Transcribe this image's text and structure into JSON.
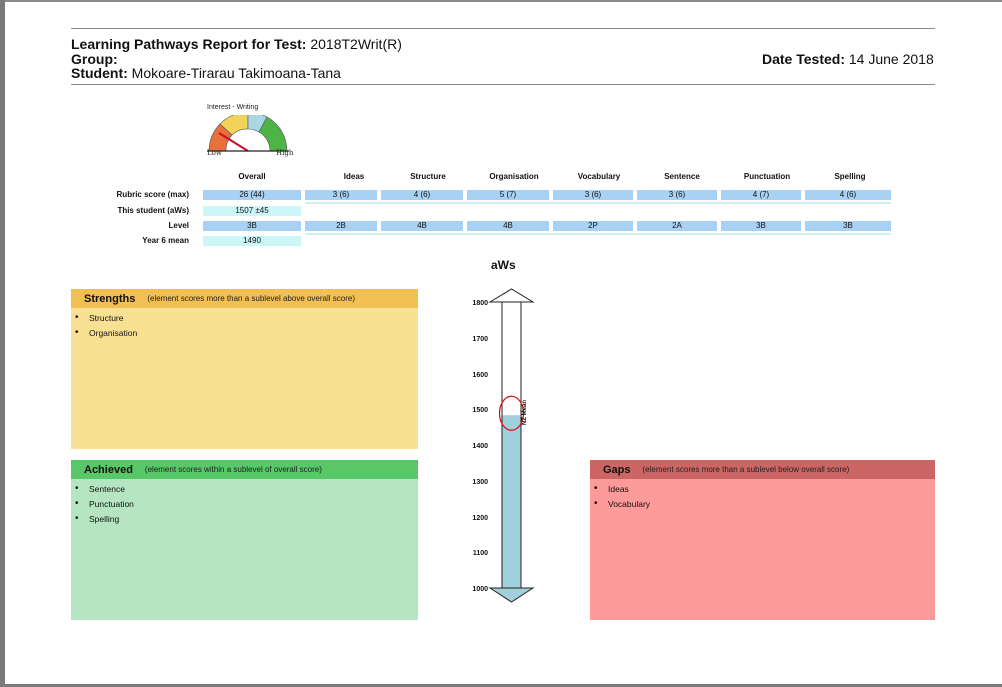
{
  "report": {
    "title_label": "Learning Pathways Report for Test:",
    "test_name": "2018T2Writ(R)",
    "group_label": "Group:",
    "group_value": "",
    "student_label": "Student:",
    "student_name": "Mokoare-Tirarau Takimoana-Tana",
    "date_label": "Date Tested:",
    "date_value": "14 June 2018"
  },
  "gauge": {
    "title": "Interest - Writing",
    "low": "Low",
    "high": "High",
    "colors": {
      "low": "#e8703a",
      "mid": "#f2d25a",
      "high": "#4fb447",
      "highlight": "#a9d7e6",
      "needle": "#c8102e"
    }
  },
  "table": {
    "columns": [
      "Overall",
      "Ideas",
      "Structure",
      "Organisation",
      "Vocabulary",
      "Sentence",
      "Punctuation",
      "Spelling"
    ],
    "row_labels": {
      "rubric": "Rubric score (max)",
      "student": "This student (aWs)",
      "level": "Level",
      "mean": "Year 6 mean"
    },
    "rubric": [
      "26 (44)",
      "3 (6)",
      "4 (6)",
      "5 (7)",
      "3 (6)",
      "3 (6)",
      "4 (7)",
      "4 (6)"
    ],
    "student": "1507 ±45",
    "level": [
      "3B",
      "2B",
      "4B",
      "4B",
      "2P",
      "2A",
      "3B",
      "3B"
    ],
    "mean": "1490"
  },
  "strengths": {
    "title": "Strengths",
    "desc": "(element scores more than a sublevel above overall score)",
    "items": [
      "Structure",
      "Organisation"
    ],
    "colors": {
      "head": "#f2bf52",
      "body": "#f9e194"
    }
  },
  "achieved": {
    "title": "Achieved",
    "desc": "(element scores within a sublevel of overall score)",
    "items": [
      "Sentence",
      "Punctuation",
      "Spelling"
    ],
    "colors": {
      "head": "#57c768",
      "body": "#b5e6c1"
    }
  },
  "gaps": {
    "title": "Gaps",
    "desc": "(element scores more than a sublevel below overall score)",
    "items": [
      "Ideas",
      "Vocabulary"
    ],
    "colors": {
      "head": "#cb6664",
      "body": "#fd9a9a"
    }
  },
  "scale": {
    "title": "aWs",
    "ticks": [
      "1800",
      "1700",
      "1600",
      "1500",
      "1400",
      "1300",
      "1200",
      "1100",
      "1000"
    ],
    "min": 1000,
    "max": 1800,
    "student_score": 1490,
    "nz_mean_label": "NZ Mean",
    "colors": {
      "fill": "#a2cfdc",
      "marker": "#d9191d"
    }
  }
}
